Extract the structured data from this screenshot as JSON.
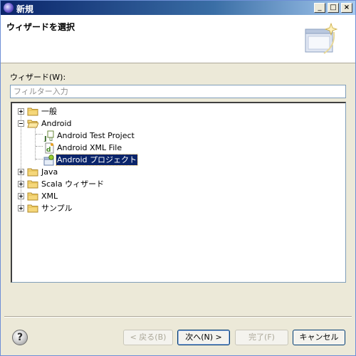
{
  "titlebar": {
    "title": "新規"
  },
  "banner": {
    "title": "ウィザードを選択"
  },
  "wizard": {
    "label": "ウィザード(W):",
    "filter_placeholder": "フィルター入力"
  },
  "tree": {
    "general": "一般",
    "android": "Android",
    "android_children": [
      "Android Test Project",
      "Android XML File",
      "Android プロジェクト"
    ],
    "java": "Java",
    "scala": "Scala ウィザード",
    "xml": "XML",
    "samples": "サンプル"
  },
  "buttons": {
    "back": "< 戻る(B)",
    "next": "次へ(N) >",
    "finish": "完了(F)",
    "cancel": "キャンセル"
  },
  "colors": {
    "selection": "#0a246a",
    "title_start": "#0a246a",
    "title_end": "#a6caf0"
  }
}
